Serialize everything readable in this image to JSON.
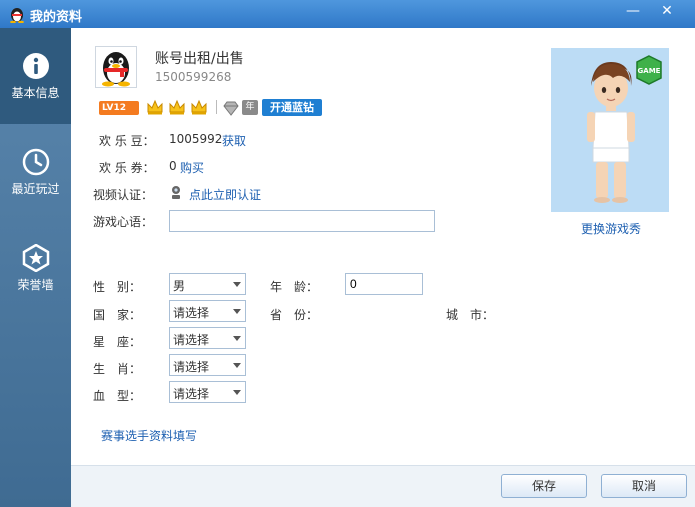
{
  "window": {
    "title": "我的资料",
    "minimize_glyph": "—",
    "close_glyph": "✕"
  },
  "sidebar": {
    "items": [
      {
        "label": "基本信息",
        "icon": "info-icon",
        "active": true
      },
      {
        "label": "最近玩过",
        "icon": "clock-icon",
        "active": false
      },
      {
        "label": "荣誉墙",
        "icon": "star-badge-icon",
        "active": false
      }
    ]
  },
  "profile": {
    "nickname": "账号出租/出售",
    "qq_number": "1500599268",
    "level_badge": "LV12",
    "year_badge": "年",
    "open_blue_diamond": "开通蓝钻"
  },
  "info": {
    "happy_beans_label": "欢 乐 豆：",
    "happy_beans_value": "1005992",
    "happy_beans_action": "获取",
    "happy_coupons_label": "欢 乐 券：",
    "happy_coupons_value": "0",
    "happy_coupons_action": "购买",
    "video_verify_label": "视频认证：",
    "video_verify_action": "点此立即认证",
    "motto_label": "游戏心语：",
    "motto_value": ""
  },
  "details": {
    "gender_label": "性　别：",
    "gender_value": "男",
    "age_label": "年　龄：",
    "age_value": "0",
    "country_label": "国　家：",
    "country_value": "请选择",
    "province_label": "省　份：",
    "city_label": "城　市：",
    "constellation_label": "星　座：",
    "constellation_value": "请选择",
    "zodiac_label": "生　肖：",
    "zodiac_value": "请选择",
    "blood_label": "血　型：",
    "blood_value": "请选择"
  },
  "game_show": {
    "change_label": "更换游戏秀",
    "logo_text": "GAME"
  },
  "tournament_link": "赛事选手资料填写",
  "footer": {
    "save_label": "保存",
    "cancel_label": "取消"
  },
  "colors": {
    "titlebar": "#3a86d4",
    "sidebar": "#4f7ba3",
    "sidebar_active": "#2f5a7e",
    "link": "#1e60b1",
    "level_badge": "#f47b20",
    "blue_diamond": "#1f7fd2"
  }
}
